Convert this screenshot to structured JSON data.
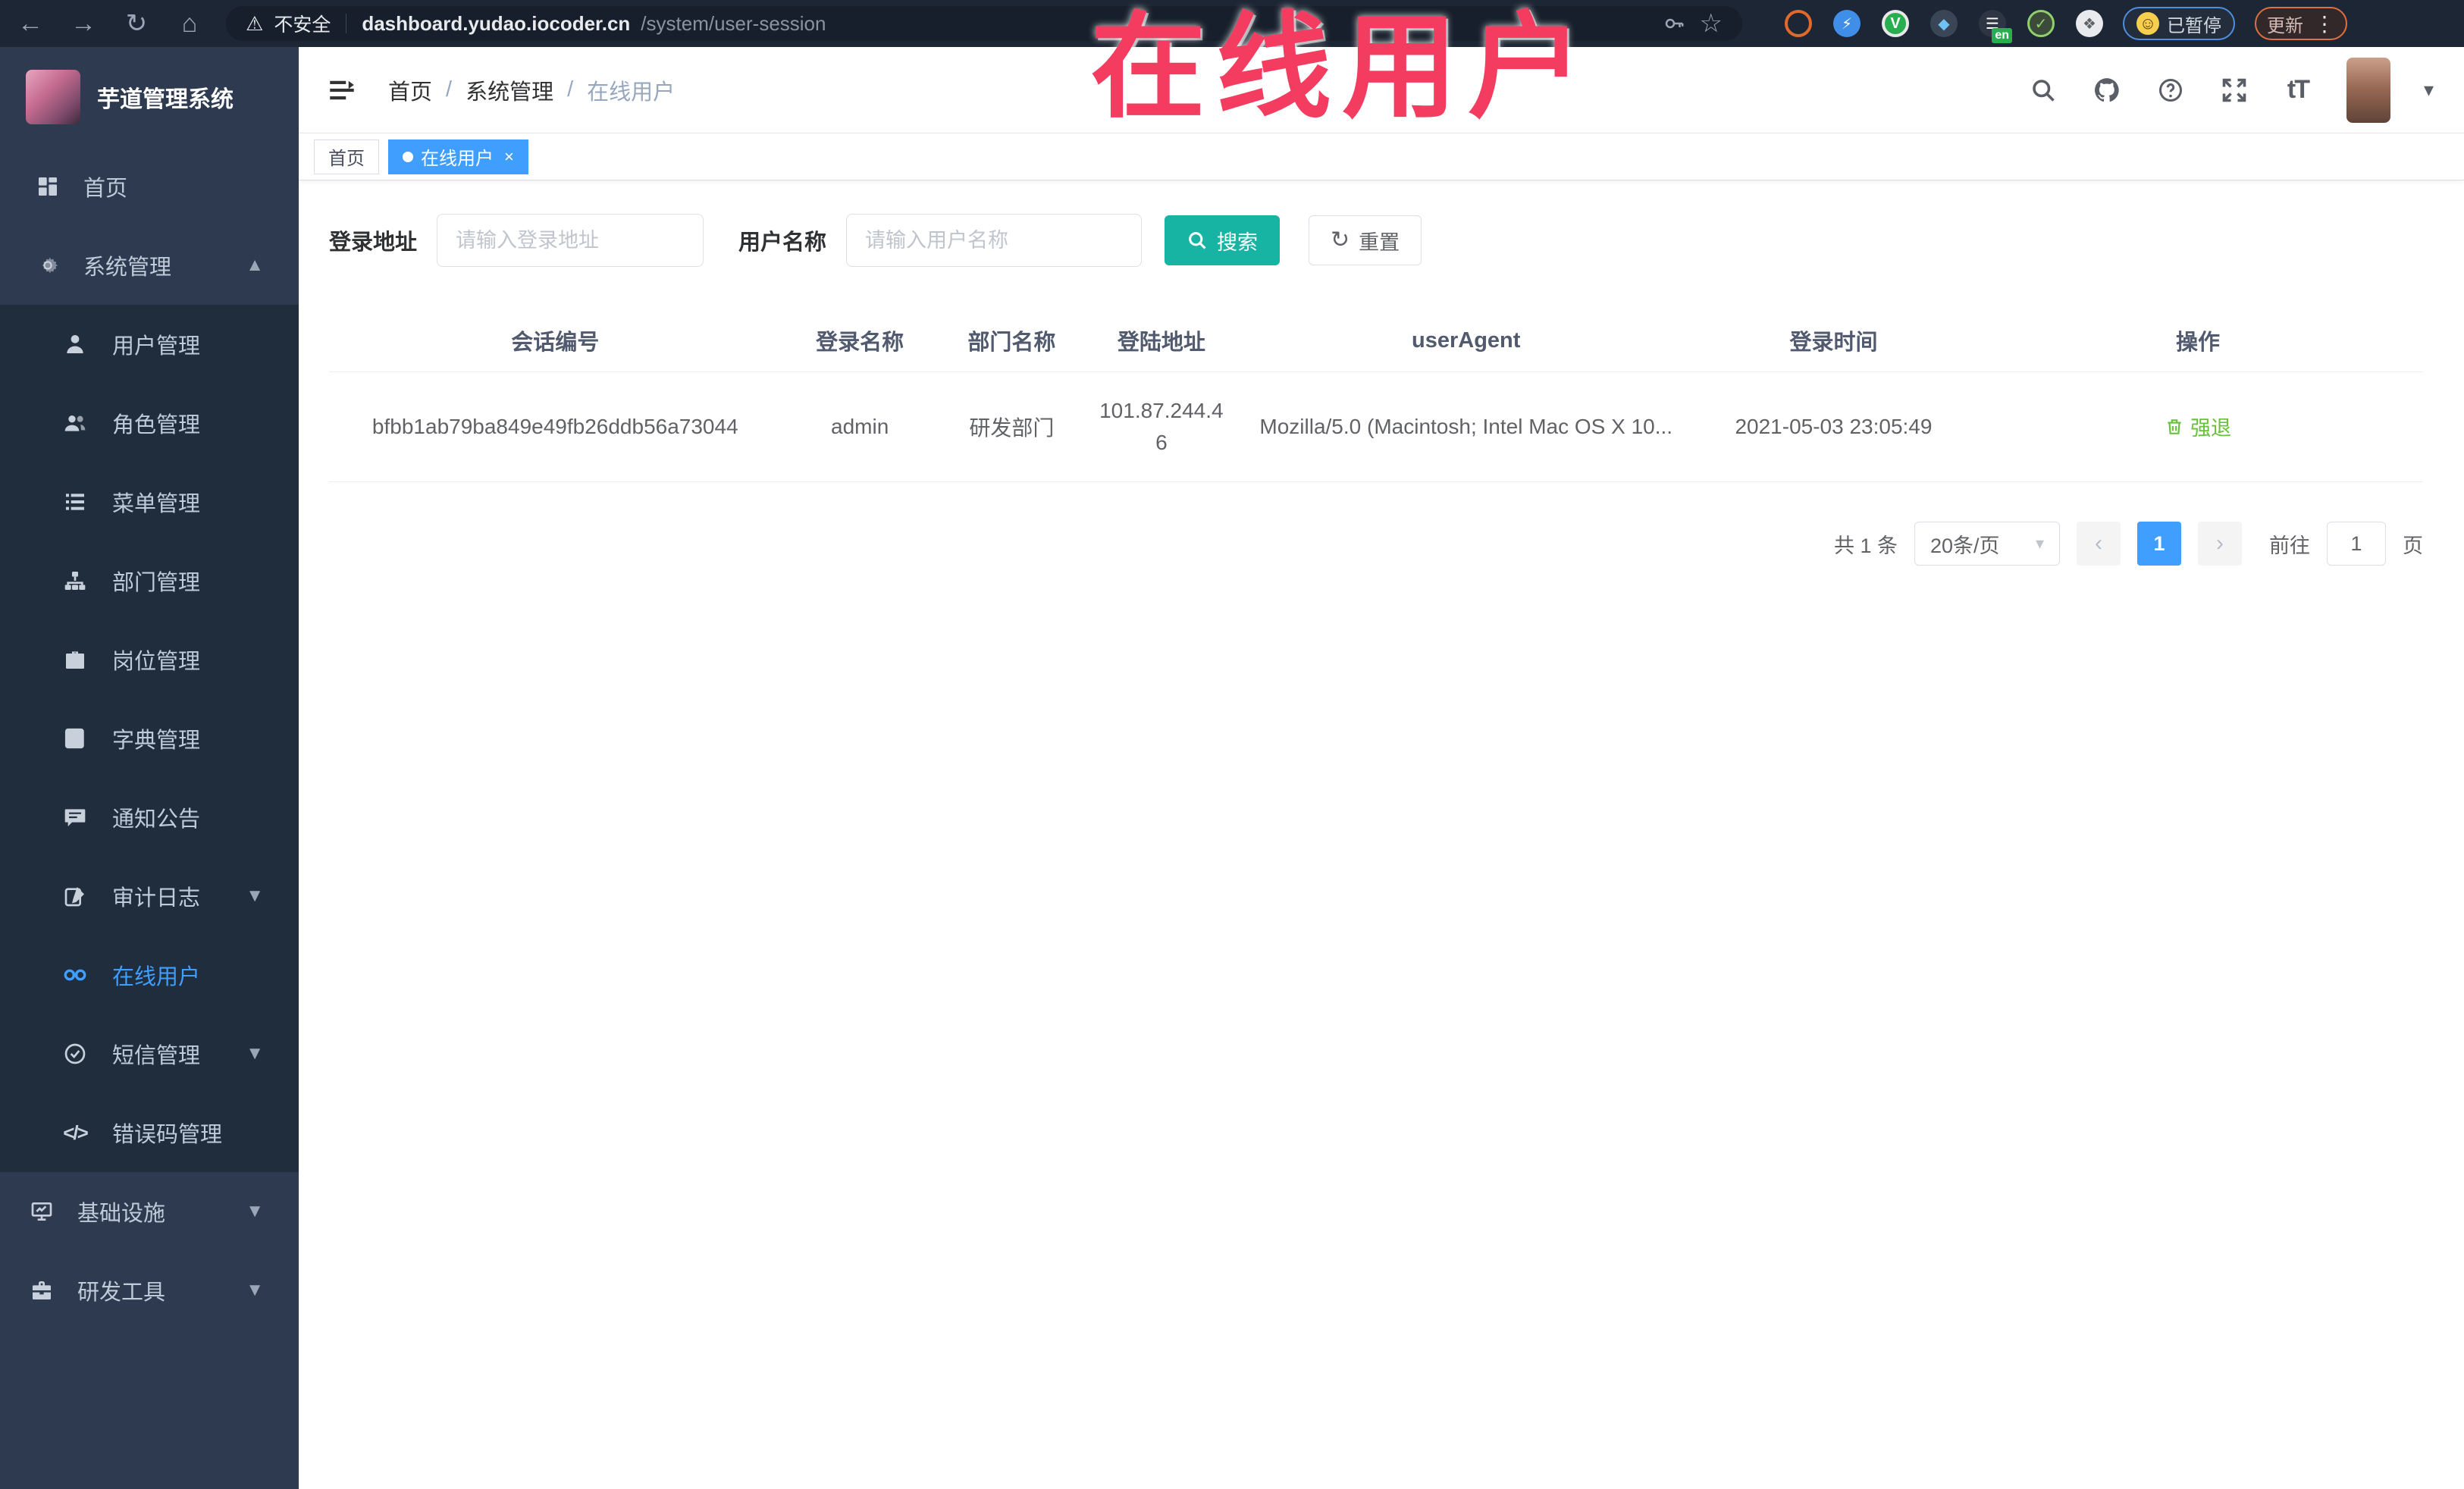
{
  "browser": {
    "security_label": "不安全",
    "url_domain": "dashboard.yudao.iocoder.cn",
    "url_path": "/system/user-session",
    "paused_badge": "已暂停",
    "update_button": "更新"
  },
  "annotation": {
    "text": "在线用户",
    "color": "#f43b60"
  },
  "sidebar": {
    "title": "芋道管理系统",
    "items": [
      {
        "label": "首页"
      },
      {
        "label": "系统管理"
      },
      {
        "label": "用户管理"
      },
      {
        "label": "角色管理"
      },
      {
        "label": "菜单管理"
      },
      {
        "label": "部门管理"
      },
      {
        "label": "岗位管理"
      },
      {
        "label": "字典管理"
      },
      {
        "label": "通知公告"
      },
      {
        "label": "审计日志"
      },
      {
        "label": "在线用户"
      },
      {
        "label": "短信管理"
      },
      {
        "label": "错误码管理"
      },
      {
        "label": "基础设施"
      },
      {
        "label": "研发工具"
      }
    ]
  },
  "header": {
    "breadcrumb": [
      "首页",
      "系统管理",
      "在线用户"
    ]
  },
  "tags": {
    "home": "首页",
    "active": "在线用户"
  },
  "filters": {
    "login_address_label": "登录地址",
    "login_address_placeholder": "请输入登录地址",
    "username_label": "用户名称",
    "username_placeholder": "请输入用户名称",
    "search_label": "搜索",
    "reset_label": "重置"
  },
  "table": {
    "columns": [
      "会话编号",
      "登录名称",
      "部门名称",
      "登陆地址",
      "userAgent",
      "登录时间",
      "操作"
    ],
    "rows": [
      {
        "session_id": "bfbb1ab79ba849e49fb26ddb56a73044",
        "username": "admin",
        "dept": "研发部门",
        "ip": "101.87.244.46",
        "user_agent": "Mozilla/5.0 (Macintosh; Intel Mac OS X 10...",
        "login_time": "2021-05-03 23:05:49",
        "action": "强退"
      }
    ]
  },
  "pagination": {
    "total": "共 1 条",
    "page_size": "20条/页",
    "current_page": "1",
    "goto_label": "前往",
    "goto_value": "1",
    "page_label": "页"
  },
  "colors": {
    "accent_blue": "#409eff",
    "teal": "#17b3a3",
    "green": "#67c23a",
    "sidebar_bg": "#2d3a4f",
    "submenu_bg": "#1f2d3d",
    "annotation_red": "#f43b60"
  }
}
